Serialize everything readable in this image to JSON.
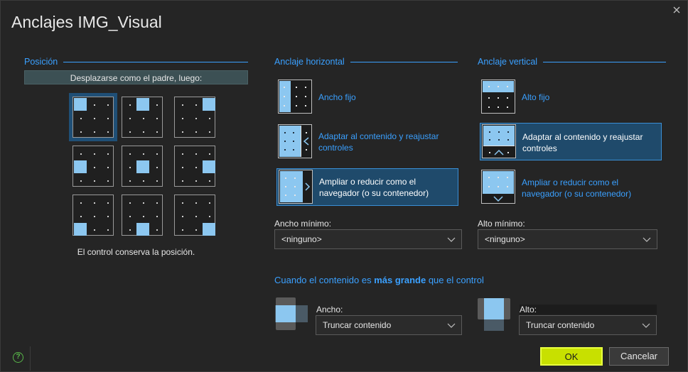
{
  "dialog": {
    "title": "Anclajes IMG_Visual",
    "close_icon": "close-icon"
  },
  "position": {
    "heading": "Posición",
    "banner": "Desplazarse como el padre, luego:",
    "caption": "El control conserva la posición.",
    "selected_cell": "top-left"
  },
  "horizontal": {
    "heading": "Anclaje horizontal",
    "options": [
      {
        "label": "Ancho fijo",
        "selected": false
      },
      {
        "label": "Adaptar al contenido y reajustar controles",
        "selected": false
      },
      {
        "label": "Ampliar o reducir como el navegador (o su contenedor)",
        "selected": true
      }
    ],
    "min_label": "Ancho mínimo:",
    "min_value": "<ninguno>"
  },
  "vertical": {
    "heading": "Anclaje vertical",
    "options": [
      {
        "label": "Alto fijo",
        "selected": false
      },
      {
        "label": "Adaptar al contenido y reajustar controles",
        "selected": true
      },
      {
        "label": "Ampliar o reducir como el navegador (o su contenedor)",
        "selected": false
      }
    ],
    "min_label": "Alto mínimo:",
    "min_value": "<ninguno>"
  },
  "larger": {
    "prefix": "Cuando el contenido es ",
    "emphasis": "más grande",
    "suffix": " que el control",
    "width_label": "Ancho:",
    "width_value": "Truncar contenido",
    "height_label": "Alto:",
    "height_value": "Truncar contenido"
  },
  "buttons": {
    "ok": "OK",
    "cancel": "Cancelar",
    "help": "?"
  },
  "colors": {
    "accent": "#3aa0ff",
    "selected_bg": "#1f4a6b",
    "fill": "#8cc7f0",
    "ok": "#c8e000"
  }
}
